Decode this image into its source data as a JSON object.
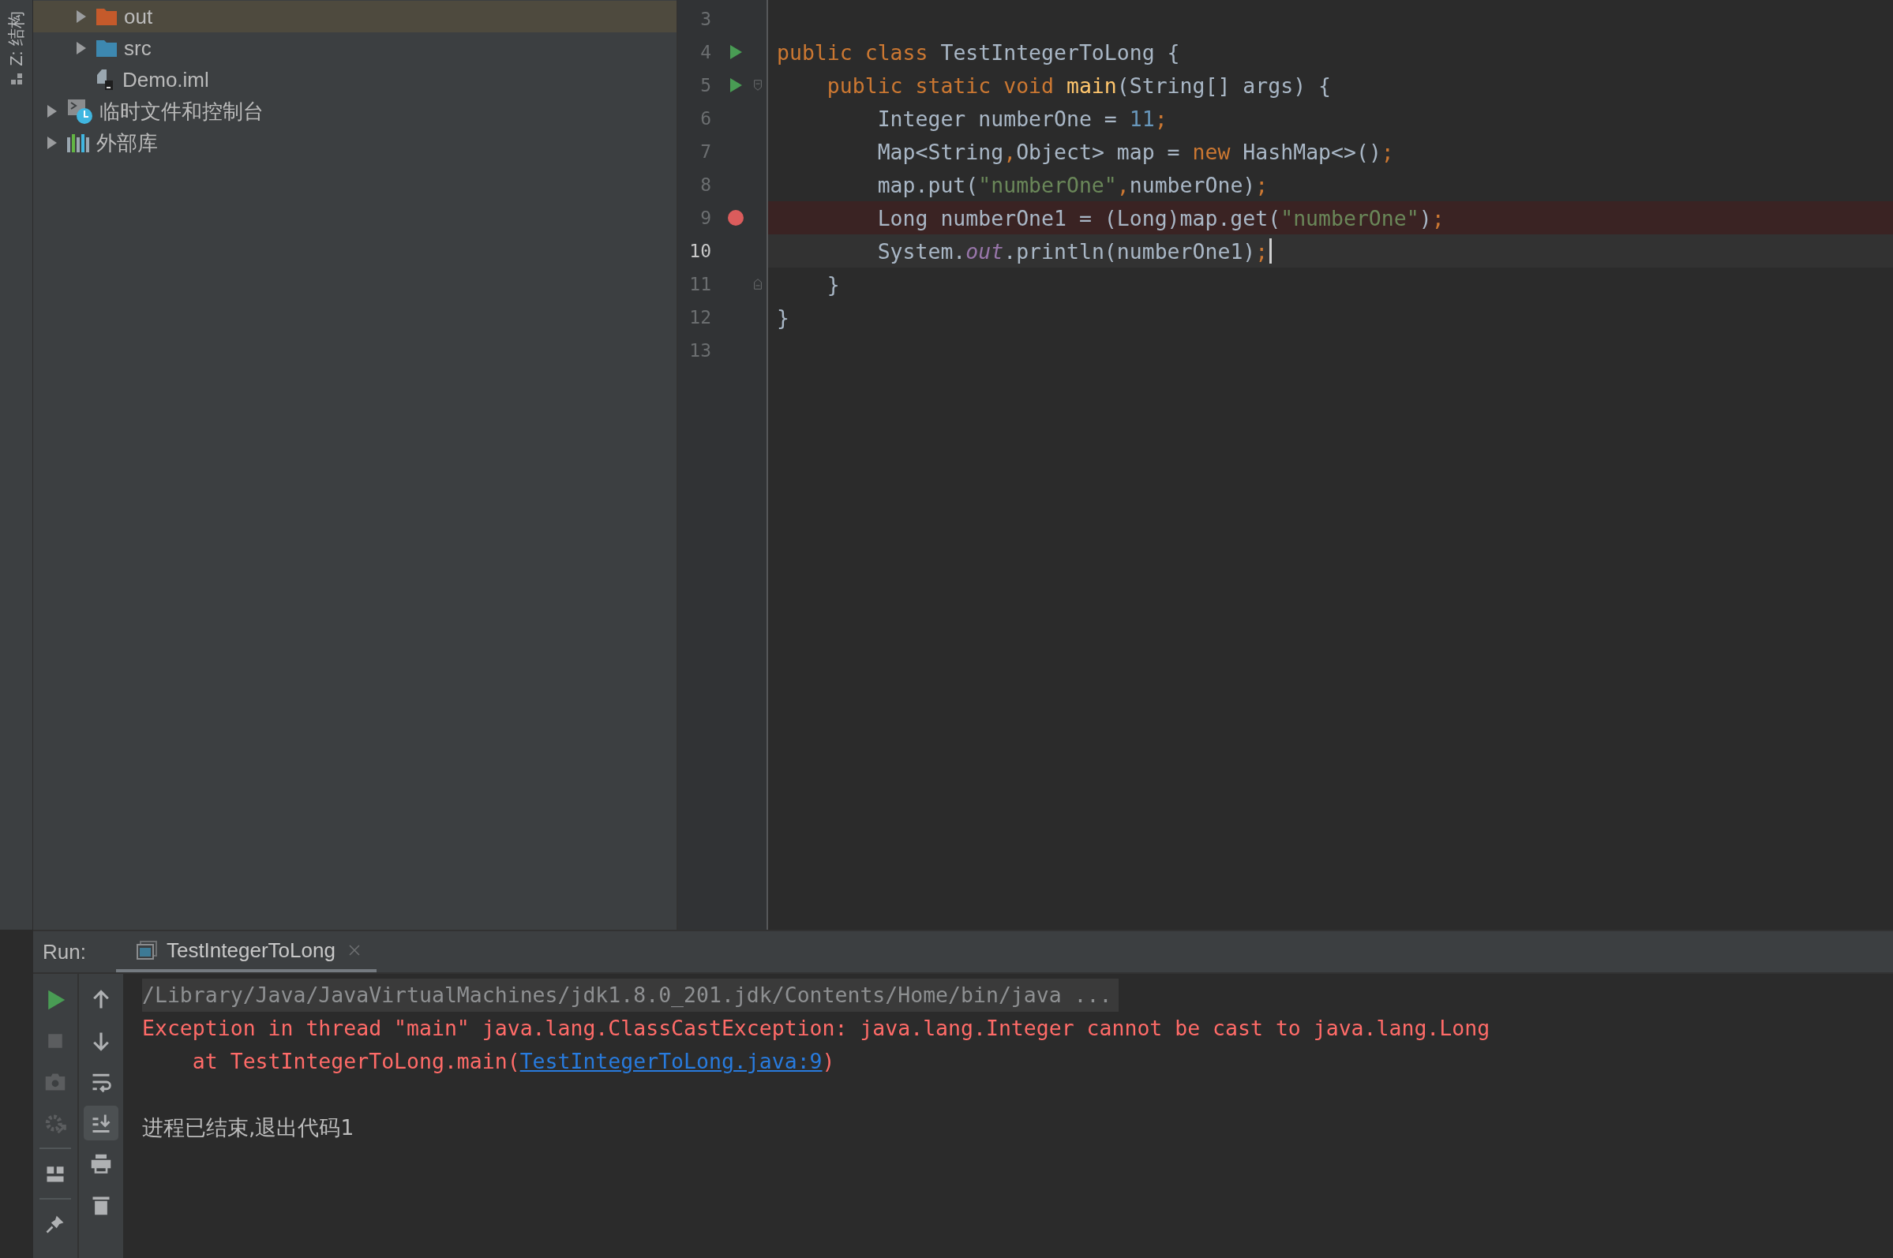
{
  "side_stripe": {
    "label": "Z: 结构"
  },
  "project_tree": [
    {
      "children": [
        {
          "label": "out",
          "kind": "excluded-folder",
          "expanded": false,
          "selected": true
        },
        {
          "label": "src",
          "kind": "source-folder",
          "expanded": false,
          "selected": false
        },
        {
          "label": "Demo.iml",
          "kind": "module-file",
          "selected": false
        }
      ]
    },
    {
      "label": "临时文件和控制台",
      "kind": "scratches",
      "expanded": false,
      "selected": false
    },
    {
      "label": "外部库",
      "kind": "libraries",
      "expanded": false,
      "selected": false
    }
  ],
  "editor": {
    "lines": [
      {
        "number": "3",
        "run_marker": false,
        "breakpoint": false,
        "current": false,
        "caret": false
      },
      {
        "number": "4",
        "run_marker": true,
        "breakpoint": false,
        "current": false,
        "caret": false,
        "tokens": [
          {
            "kind": "keyword",
            "text": "public class "
          },
          {
            "kind": "plain",
            "text": "TestIntegerToLong {"
          }
        ]
      },
      {
        "number": "5",
        "run_marker": true,
        "breakpoint": false,
        "current": false,
        "caret": false,
        "fold_start": true,
        "fold_end": false,
        "tokens": [
          {
            "kind": "keyword",
            "text": "    public static void "
          },
          {
            "kind": "method",
            "text": "main"
          },
          {
            "kind": "plain",
            "text": "(String[] args) {"
          }
        ]
      },
      {
        "number": "6",
        "run_marker": false,
        "breakpoint": false,
        "current": false,
        "caret": false,
        "tokens": [
          {
            "kind": "plain",
            "text": "        Integer numberOne = "
          },
          {
            "kind": "number",
            "text": "11"
          },
          {
            "kind": "keyword",
            "text": ";"
          }
        ]
      },
      {
        "number": "7",
        "run_marker": false,
        "breakpoint": false,
        "current": false,
        "caret": false,
        "tokens": [
          {
            "kind": "plain",
            "text": "        Map<String"
          },
          {
            "kind": "keyword",
            "text": ","
          },
          {
            "kind": "plain",
            "text": "Object> map = "
          },
          {
            "kind": "keyword",
            "text": "new "
          },
          {
            "kind": "plain",
            "text": "HashMap<>()"
          },
          {
            "kind": "keyword",
            "text": ";"
          }
        ]
      },
      {
        "number": "8",
        "run_marker": false,
        "breakpoint": false,
        "current": false,
        "caret": false,
        "tokens": [
          {
            "kind": "plain",
            "text": "        map.put("
          },
          {
            "kind": "string",
            "text": "\"numberOne\""
          },
          {
            "kind": "keyword",
            "text": ","
          },
          {
            "kind": "plain",
            "text": "numberOne)"
          },
          {
            "kind": "keyword",
            "text": ";"
          }
        ]
      },
      {
        "number": "9",
        "run_marker": false,
        "breakpoint": true,
        "current": false,
        "caret": false,
        "tokens": [
          {
            "kind": "plain",
            "text": "        Long numberOne1 = (Long)map.get("
          },
          {
            "kind": "string",
            "text": "\"numberOne\""
          },
          {
            "kind": "plain",
            "text": ")"
          },
          {
            "kind": "keyword",
            "text": ";"
          }
        ]
      },
      {
        "number": "10",
        "run_marker": false,
        "breakpoint": false,
        "current": true,
        "caret": true,
        "tokens": [
          {
            "kind": "plain",
            "text": "        System."
          },
          {
            "kind": "field",
            "text": "out"
          },
          {
            "kind": "plain",
            "text": ".println(numberOne1)"
          },
          {
            "kind": "keyword",
            "text": ";"
          }
        ]
      },
      {
        "number": "11",
        "run_marker": false,
        "breakpoint": false,
        "current": false,
        "caret": false,
        "fold_start": false,
        "fold_end": true,
        "tokens": [
          {
            "kind": "plain",
            "text": "    }"
          }
        ]
      },
      {
        "number": "12",
        "run_marker": false,
        "breakpoint": false,
        "current": false,
        "caret": false,
        "tokens": [
          {
            "kind": "plain",
            "text": "}"
          }
        ]
      },
      {
        "number": "13",
        "run_marker": false,
        "breakpoint": false,
        "current": false,
        "caret": false
      }
    ]
  },
  "run_panel": {
    "label": "Run:",
    "tabs": [
      {
        "title": "TestIntegerToLong",
        "selected": true,
        "closable": true
      }
    ],
    "toolbar_left": [
      {
        "kind": "run",
        "disabled": false
      },
      {
        "kind": "stop",
        "disabled": true
      },
      {
        "kind": "snapshot",
        "disabled": true
      },
      {
        "kind": "settings",
        "disabled": true
      },
      {
        "kind": "separator"
      },
      {
        "kind": "layout",
        "disabled": false
      },
      {
        "kind": "separator"
      },
      {
        "kind": "pin",
        "disabled": false
      }
    ],
    "toolbar_right": [
      {
        "kind": "up",
        "toggled": false
      },
      {
        "kind": "down",
        "toggled": false
      },
      {
        "kind": "wrap",
        "toggled": false
      },
      {
        "kind": "scroll-end",
        "toggled": true
      },
      {
        "kind": "print",
        "toggled": false
      },
      {
        "kind": "clear",
        "toggled": false
      }
    ],
    "console": [
      {
        "kind": "command",
        "text": "/Library/Java/JavaVirtualMachines/jdk1.8.0_201.jdk/Contents/Home/bin/java ..."
      },
      {
        "kind": "error",
        "segments": [
          {
            "kind": "plain",
            "text": "Exception in thread \"main\" java.lang.ClassCastException: java.lang.Integer cannot be cast to java.lang.Long"
          }
        ]
      },
      {
        "kind": "error",
        "segments": [
          {
            "kind": "plain",
            "text": "    at TestIntegerToLong.main("
          },
          {
            "kind": "link",
            "text": "TestIntegerToLong.java:9"
          },
          {
            "kind": "plain",
            "text": ")"
          }
        ]
      },
      {
        "kind": "blank"
      },
      {
        "kind": "info",
        "text": "进程已结束,退出代码1"
      }
    ]
  }
}
